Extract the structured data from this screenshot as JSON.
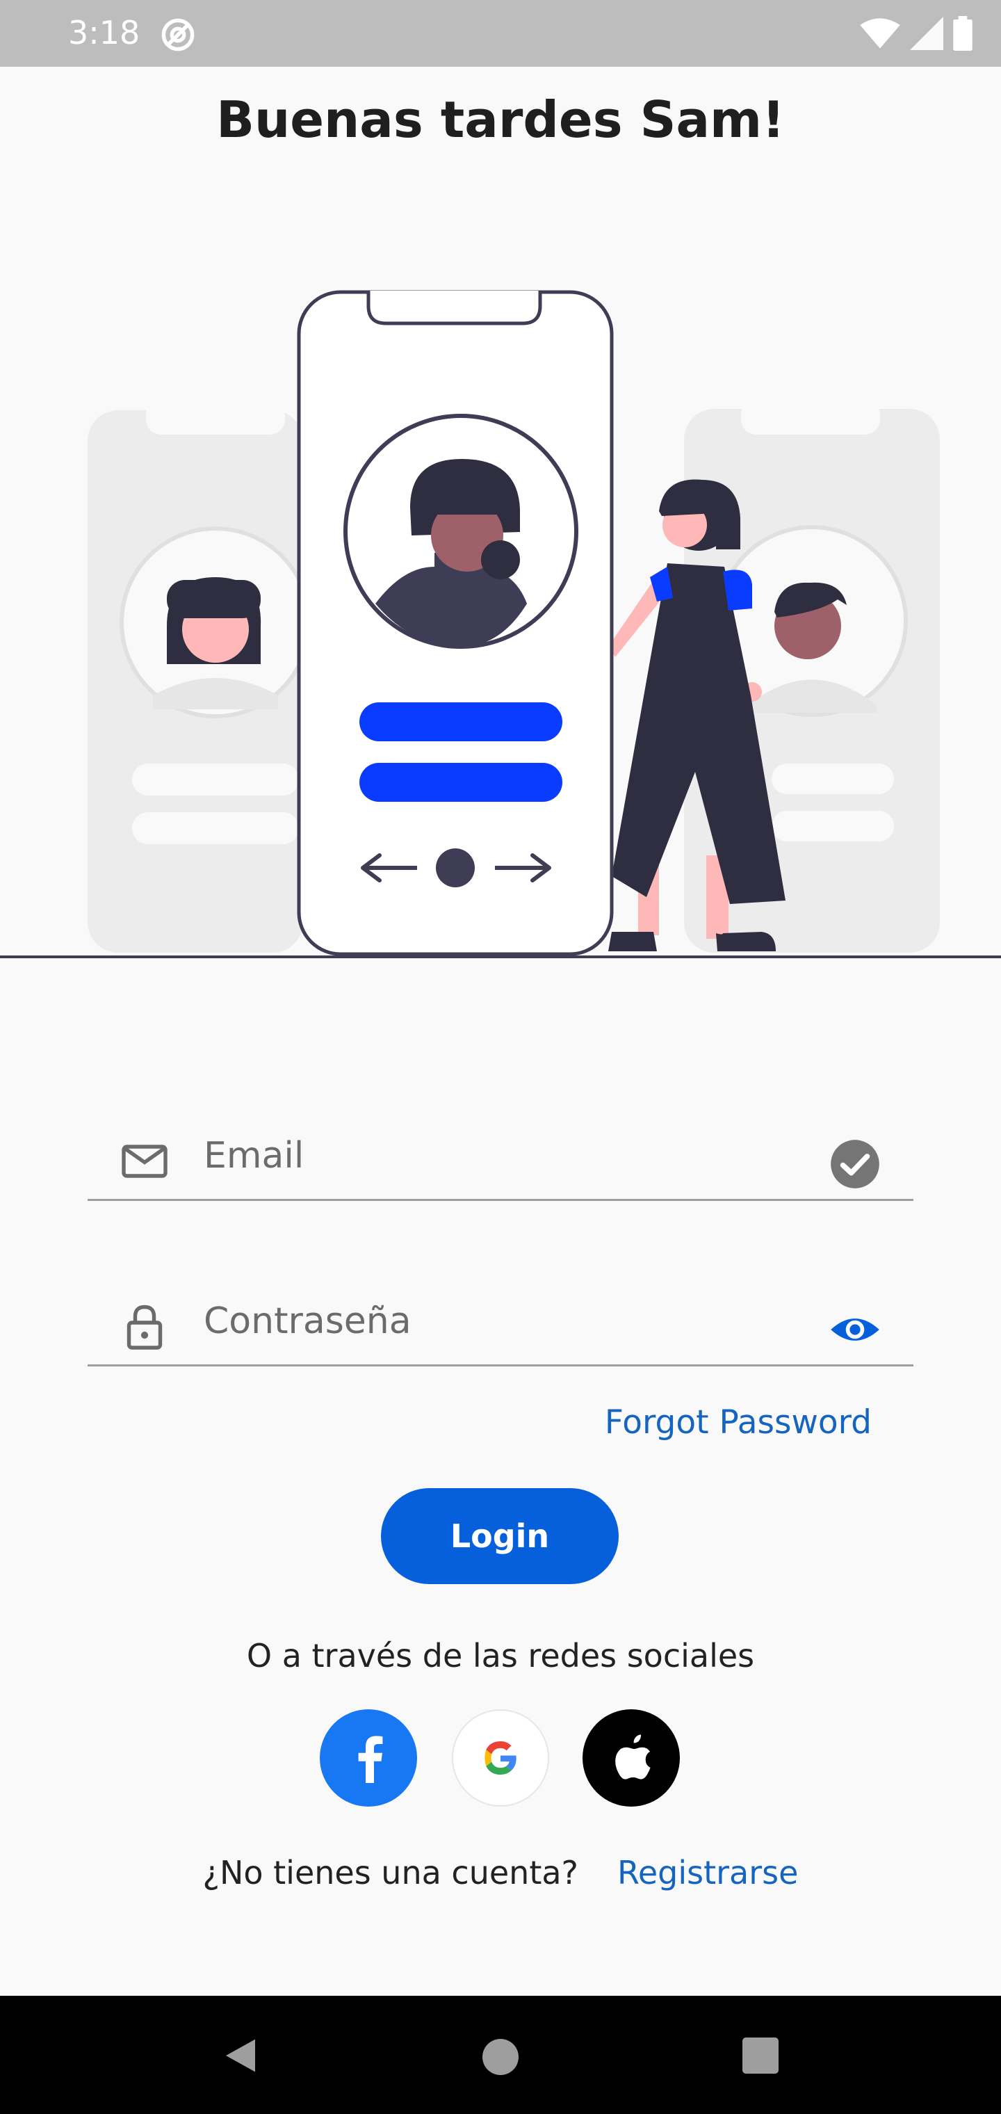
{
  "status_bar": {
    "time": "3:18"
  },
  "header": {
    "greeting": "Buenas tardes Sam!"
  },
  "form": {
    "email": {
      "placeholder": "Email"
    },
    "password": {
      "placeholder": "Contraseña"
    },
    "forgot_label": "Forgot Password",
    "login_label": "Login"
  },
  "social": {
    "label": "O a través de las redes sociales",
    "providers": [
      "facebook",
      "google",
      "apple"
    ]
  },
  "signup": {
    "question": "¿No tienes una cuenta?",
    "link": "Registrarse"
  },
  "colors": {
    "accent": "#0660dc",
    "link": "#1565c0",
    "illustration_blue": "#0a3cff",
    "facebook": "#1877f2"
  }
}
